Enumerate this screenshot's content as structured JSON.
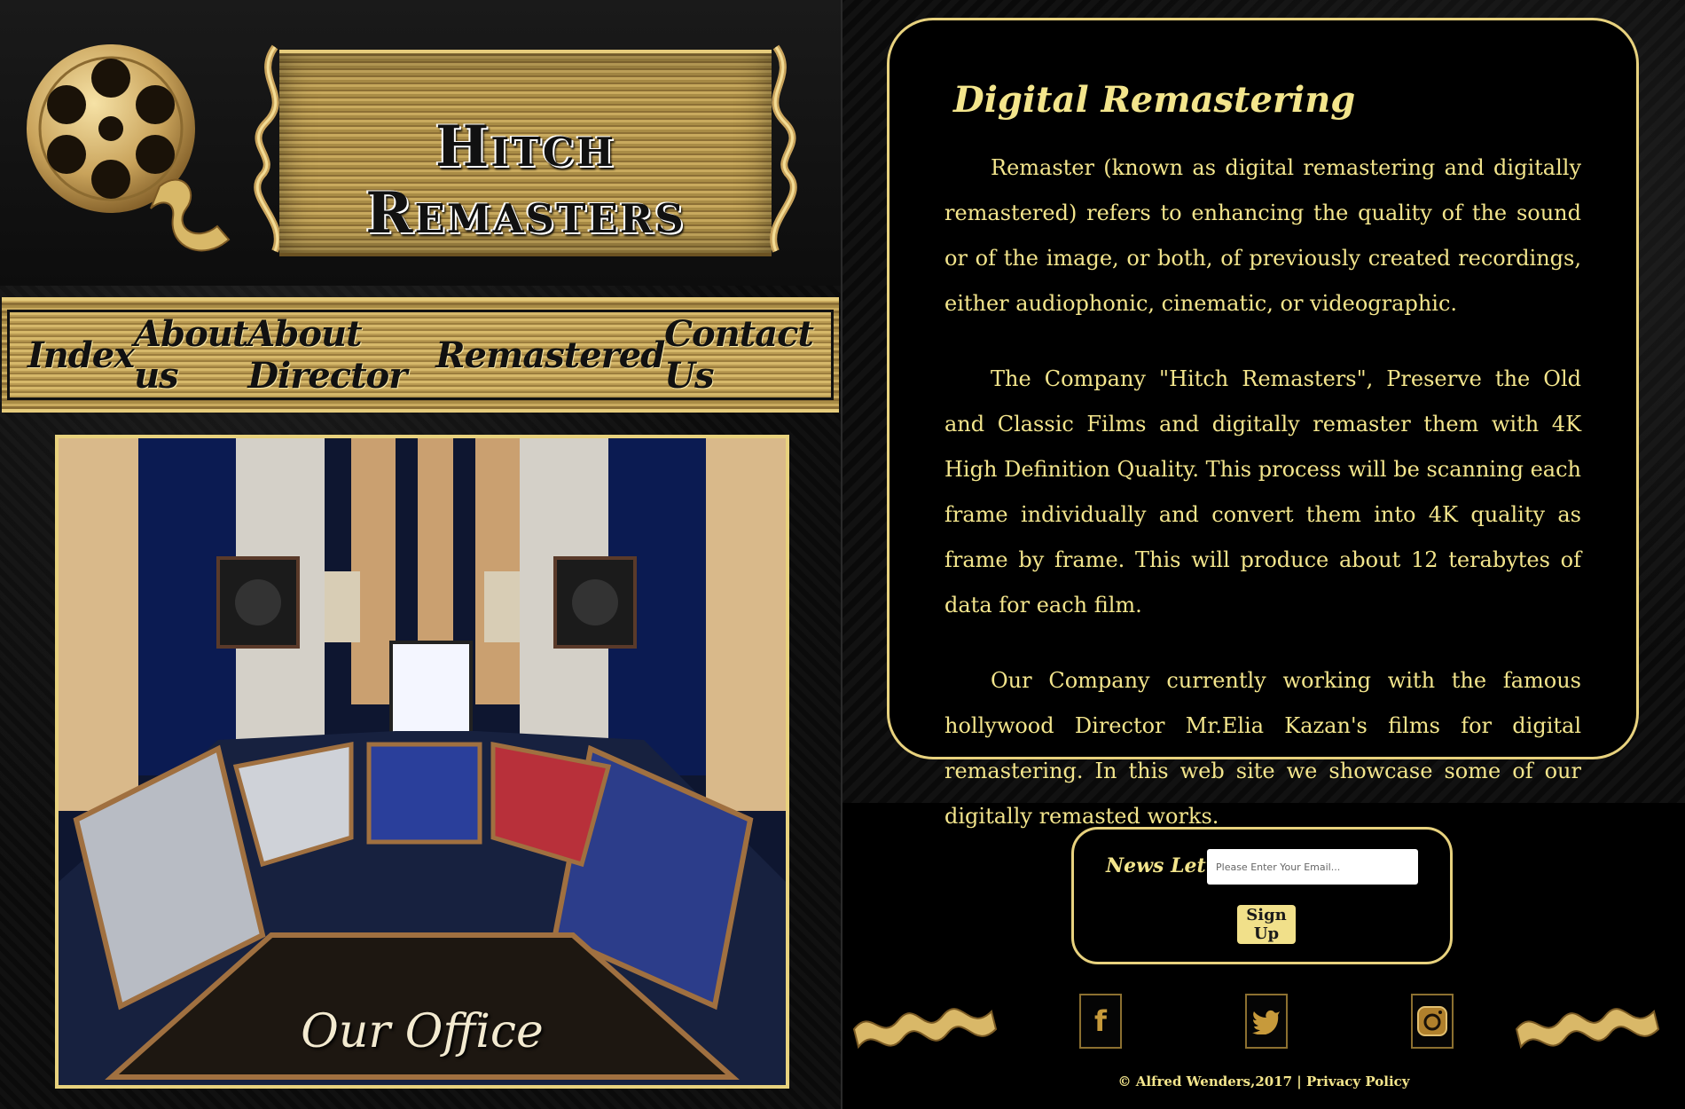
{
  "site": {
    "title": "Hitch Remasters"
  },
  "nav": {
    "items": [
      "Index",
      "About us",
      "About Director",
      "Remastered",
      "Contact Us"
    ]
  },
  "office": {
    "caption": "Our Office"
  },
  "content": {
    "title": "Digital Remastering",
    "paragraphs": [
      "Remaster (known as digital remastering and digitally remastered) refers to enhancing the quality of the sound or of the image, or both, of previously created recordings, either audiophonic, cinematic, or videographic.",
      "The Company \"Hitch Remasters\", Preserve the Old and Classic Films and digitally remaster them with 4K High Definition Quality. This process will be scanning each frame individually and convert them into 4K quality as frame by frame. This will produce about 12 terabytes of data for each film.",
      "Our Company currently working with the famous hollywood Director Mr.Elia Kazan's films for digital remastering. In this web site we showcase some of our digitally remasted works."
    ]
  },
  "newsletter": {
    "label": "News Letter :",
    "placeholder": "Please Enter Your Email...",
    "button": "Sign Up"
  },
  "social": {
    "icons": [
      "facebook-icon",
      "twitter-icon",
      "instagram-icon"
    ],
    "glyphs": {
      "facebook": "f",
      "twitter": "🐦"
    }
  },
  "footer": {
    "copyright": "© Alfred Wenders,2017 | Privacy Policy"
  },
  "colors": {
    "gold": "#e8d27e",
    "text": "#f3e58c",
    "background": "#000000"
  }
}
